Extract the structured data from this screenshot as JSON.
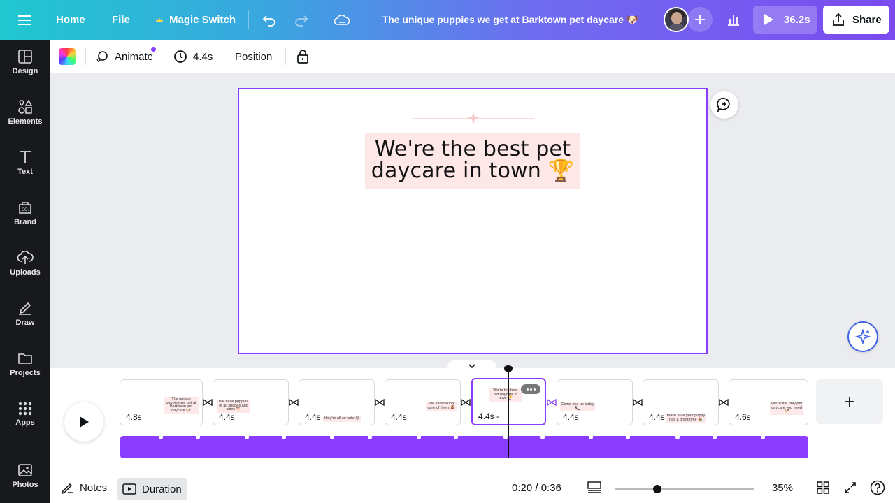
{
  "topbar": {
    "home": "Home",
    "file": "File",
    "magic_switch": "Magic Switch",
    "title": "The unique puppies we get at Barktown pet daycare 🐶",
    "play_time": "36.2s",
    "share": "Share"
  },
  "toolbar": {
    "animate": "Animate",
    "duration": "4.4s",
    "position": "Position"
  },
  "sidebar": {
    "items": [
      {
        "label": "Design",
        "icon": "design-icon"
      },
      {
        "label": "Elements",
        "icon": "elements-icon"
      },
      {
        "label": "Text",
        "icon": "text-icon"
      },
      {
        "label": "Brand",
        "icon": "brand-icon"
      },
      {
        "label": "Uploads",
        "icon": "uploads-icon"
      },
      {
        "label": "Draw",
        "icon": "draw-icon"
      },
      {
        "label": "Projects",
        "icon": "projects-icon"
      },
      {
        "label": "Apps",
        "icon": "apps-icon"
      },
      {
        "label": "Photos",
        "icon": "photos-icon"
      }
    ]
  },
  "canvas": {
    "headline_line1": "We're the best pet",
    "headline_line2": "daycare in town 🏆"
  },
  "timeline": {
    "pages": [
      {
        "duration": "4.8s",
        "mini": "The unique puppies we get at Barktown pet daycare 🐶"
      },
      {
        "duration": "4.4s",
        "mini": "We have puppies of all shapes and sizes 🐕"
      },
      {
        "duration": "4.4s",
        "mini": "they're all so cute 😍"
      },
      {
        "duration": "4.4s",
        "mini": "We love taking care of them 🧸"
      },
      {
        "duration": "4.4s -",
        "mini": "We're the best pet daycare in town 🏆"
      },
      {
        "duration": "4.4s",
        "mini": "Come see us today 📞"
      },
      {
        "duration": "4.4s",
        "mini": "make sure your puppy has a great time 🎉"
      },
      {
        "duration": "4.6s",
        "mini": "We're the only pet daycare you need 🐶"
      }
    ],
    "current_page": 5
  },
  "bottombar": {
    "notes": "Notes",
    "duration": "Duration",
    "time": "0:20 / 0:36",
    "zoom": "35%",
    "zoom_level": 0.35
  },
  "colors": {
    "accent": "#8b3dff",
    "sidebar_bg": "#18191b",
    "headline_bg": "#fde7e7"
  }
}
